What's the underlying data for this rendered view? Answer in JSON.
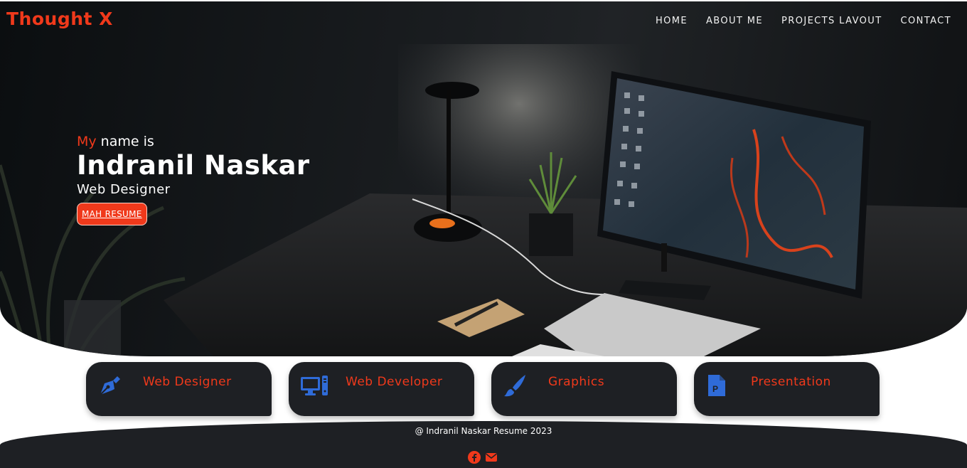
{
  "brand": {
    "name": "Thought X"
  },
  "nav": {
    "items": [
      "HOME",
      "ABOUT ME",
      "PROJECTS LAVOUT",
      "CONTACT"
    ]
  },
  "hero": {
    "intro_accent": "My",
    "intro_rest": " name is",
    "name": "Indranil Naskar",
    "role": "Web Designer",
    "resume_button": "MAH RESUME"
  },
  "services": [
    {
      "label": "Web Designer",
      "icon": "pen-nib-icon"
    },
    {
      "label": "Web Developer",
      "icon": "desktop-computer-icon"
    },
    {
      "label": "Graphics",
      "icon": "paint-brush-icon"
    },
    {
      "label": "Presentation",
      "icon": "powerpoint-file-icon"
    }
  ],
  "footer": {
    "copyright": "@ Indranil Naskar Resume 2023",
    "social": [
      "facebook-icon",
      "envelope-icon"
    ]
  },
  "colors": {
    "accent": "#f0391b",
    "card_bg": "#1e2024",
    "icon_blue": "#2f6bd8"
  }
}
